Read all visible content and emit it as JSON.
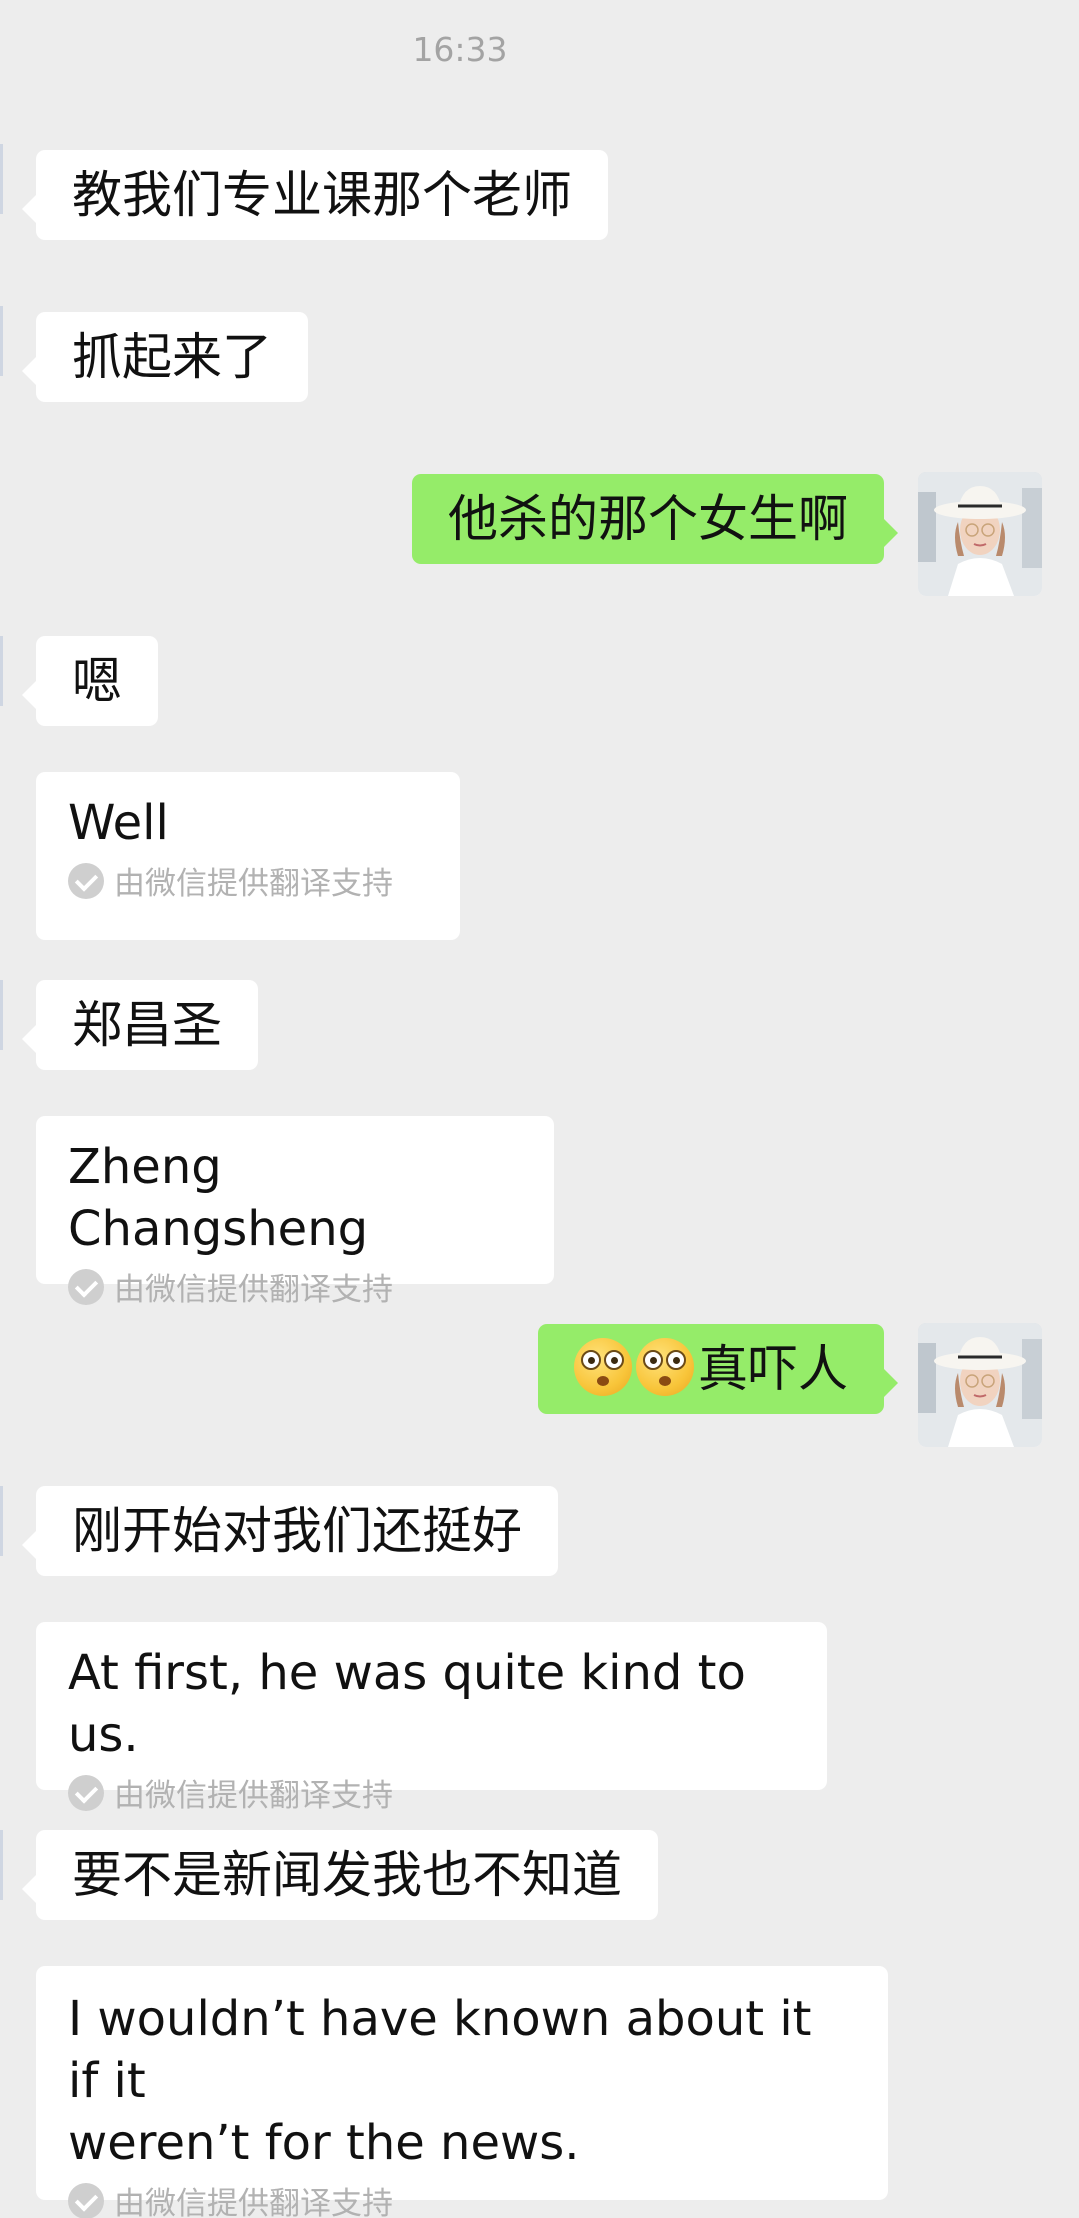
{
  "timestamp": "16:33",
  "messages": [
    {
      "text": "教我们专业课那个老师"
    },
    {
      "text": "抓起来了"
    },
    {
      "text": "他杀的那个女生啊"
    },
    {
      "text": "嗯",
      "translation": "Well"
    },
    {
      "text": "郑昌圣",
      "translation": "Zheng Changsheng"
    },
    {
      "text": "真吓人"
    },
    {
      "text": "刚开始对我们还挺好",
      "translation": "At first, he was quite kind to us."
    },
    {
      "text": "要不是新闻发我也不知道",
      "translation": "I wouldn’t have known about it if it\nweren’t for the news."
    }
  ],
  "translation_note": "由微信提供翻译支持",
  "emoji_name": "flushed-face-icon",
  "colors": {
    "background": "#ededed",
    "incoming_bubble": "#ffffff",
    "outgoing_bubble": "#95ec69",
    "muted_text": "#b2b2b2"
  }
}
